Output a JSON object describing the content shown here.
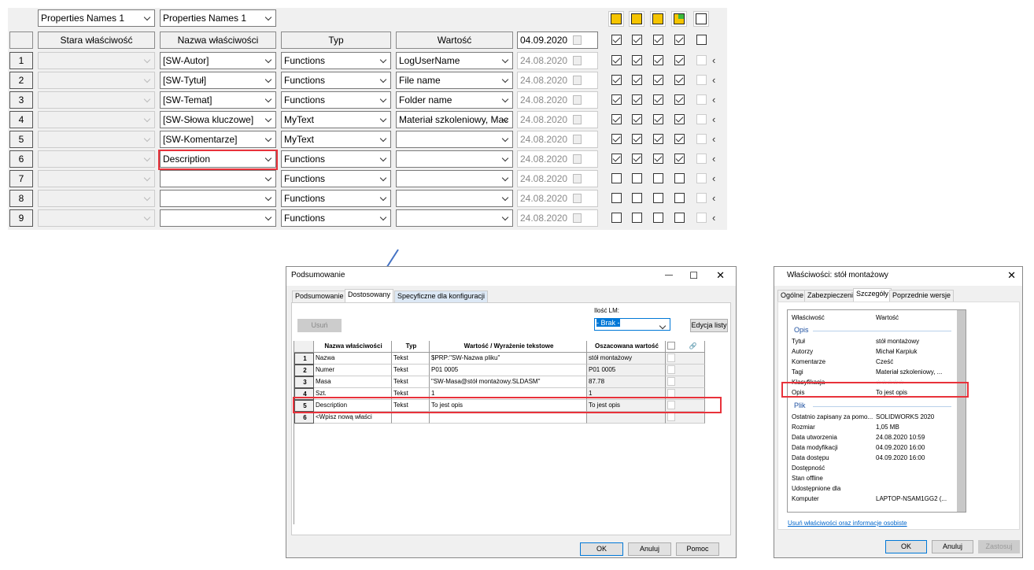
{
  "top_grid": {
    "selector_left": "Properties Names 1",
    "selector_right": "Properties Names 1",
    "headers": {
      "old": "Stara właściwość",
      "name": "Nazwa właściwości",
      "type": "Typ",
      "value": "Wartość",
      "date": "04.09.2020"
    },
    "header_checks": [
      true,
      true,
      true,
      true,
      false
    ],
    "icons": [
      "part-icon",
      "assembly-icon",
      "drawing-icon",
      "sheet-metal-icon",
      "configuration-icon"
    ],
    "rows": [
      {
        "num": "1",
        "name": "[SW-Autor]",
        "type": "Functions",
        "value": "LogUserName",
        "date": "24.08.2020",
        "checks": [
          true,
          true,
          true,
          true
        ]
      },
      {
        "num": "2",
        "name": "[SW-Tytuł]",
        "type": "Functions",
        "value": "File name",
        "date": "24.08.2020",
        "checks": [
          true,
          true,
          true,
          true
        ]
      },
      {
        "num": "3",
        "name": "[SW-Temat]",
        "type": "Functions",
        "value": "Folder name",
        "date": "24.08.2020",
        "checks": [
          true,
          true,
          true,
          true
        ]
      },
      {
        "num": "4",
        "name": "[SW-Słowa kluczowe]",
        "type": "MyText",
        "value": "Materiał szkoleniowy, Mac",
        "date": "24.08.2020",
        "checks": [
          true,
          true,
          true,
          true
        ]
      },
      {
        "num": "5",
        "name": "[SW-Komentarze]",
        "type": "MyText",
        "value": "",
        "date": "24.08.2020",
        "checks": [
          true,
          true,
          true,
          true
        ]
      },
      {
        "num": "6",
        "name": "Description",
        "type": "Functions",
        "value": "",
        "date": "24.08.2020",
        "checks": [
          true,
          true,
          true,
          true
        ]
      },
      {
        "num": "7",
        "name": "",
        "type": "Functions",
        "value": "",
        "date": "24.08.2020",
        "checks": [
          false,
          false,
          false,
          false
        ]
      },
      {
        "num": "8",
        "name": "",
        "type": "Functions",
        "value": "",
        "date": "24.08.2020",
        "checks": [
          false,
          false,
          false,
          false
        ]
      },
      {
        "num": "9",
        "name": "",
        "type": "Functions",
        "value": "",
        "date": "24.08.2020",
        "checks": [
          false,
          false,
          false,
          false
        ]
      }
    ]
  },
  "summary_dialog": {
    "title": "Podsumowanie",
    "tabs": [
      "Podsumowanie",
      "Dostosowany",
      "Specyficzne dla konfiguracji"
    ],
    "delete_label": "Usuń",
    "bom_label": "Ilość LM:",
    "bom_value": "- Brak -",
    "edit_list_label": "Edycja listy",
    "headers": [
      "Nazwa właściwości",
      "Typ",
      "Wartość / Wyrażenie tekstowe",
      "Oszacowana wartość"
    ],
    "rows": [
      {
        "num": "1",
        "name": "Nazwa",
        "type": "Tekst",
        "value": "$PRP:\"SW-Nazwa pliku\"",
        "evaluated": "stół montażowy"
      },
      {
        "num": "2",
        "name": "Numer",
        "type": "Tekst",
        "value": "P01 0005",
        "evaluated": "P01 0005"
      },
      {
        "num": "3",
        "name": "Masa",
        "type": "Tekst",
        "value": "\"SW-Masa@stół montażowy.SLDASM\"",
        "evaluated": "87.78"
      },
      {
        "num": "4",
        "name": "Szt.",
        "type": "Tekst",
        "value": "1",
        "evaluated": "1"
      },
      {
        "num": "5",
        "name": "Description",
        "type": "Tekst",
        "value": "To jest opis",
        "evaluated": "To jest opis"
      },
      {
        "num": "6",
        "name": "<Wpisz nową właści",
        "type": "",
        "value": "",
        "evaluated": ""
      }
    ],
    "ok": "OK",
    "cancel": "Anuluj",
    "help": "Pomoc"
  },
  "props_dialog": {
    "title": "Właściwości: stół montażowy",
    "tabs": [
      "Ogólne",
      "Zabezpieczenia",
      "Szczegóły",
      "Poprzednie wersje"
    ],
    "col_property": "Właściwość",
    "col_value": "Wartość",
    "section_desc": "Opis",
    "section_file": "Plik",
    "desc_rows": [
      [
        "Tytuł",
        "stół montażowy"
      ],
      [
        "Autorzy",
        "Michał Karpiuk"
      ],
      [
        "Komentarze",
        "Cześć"
      ],
      [
        "Tagi",
        "Materiał szkoleniowy, ..."
      ],
      [
        "Klasyfikacja",
        "☆☆☆☆☆"
      ],
      [
        "Opis",
        "To jest opis"
      ]
    ],
    "file_rows": [
      [
        "Ostatnio zapisany za pomo...",
        "SOLIDWORKS 2020"
      ],
      [
        "Rozmiar",
        "1,05 MB"
      ],
      [
        "Data utworzenia",
        "24.08.2020 10:59"
      ],
      [
        "Data modyfikacji",
        "04.09.2020 16:00"
      ],
      [
        "Data dostępu",
        "04.09.2020 16:00"
      ],
      [
        "Dostępność",
        ""
      ],
      [
        "Stan offline",
        ""
      ],
      [
        "Udostępnione dla",
        ""
      ],
      [
        "Komputer",
        "LAPTOP-NSAM1GG2 (..."
      ]
    ],
    "remove_link": "Usuń właściwości oraz informacje osobiste",
    "ok": "OK",
    "cancel": "Anuluj",
    "apply": "Zastosuj"
  },
  "colors": {
    "highlight": "#e8323b",
    "arrow": "#4472c4",
    "link": "#0066cc"
  }
}
